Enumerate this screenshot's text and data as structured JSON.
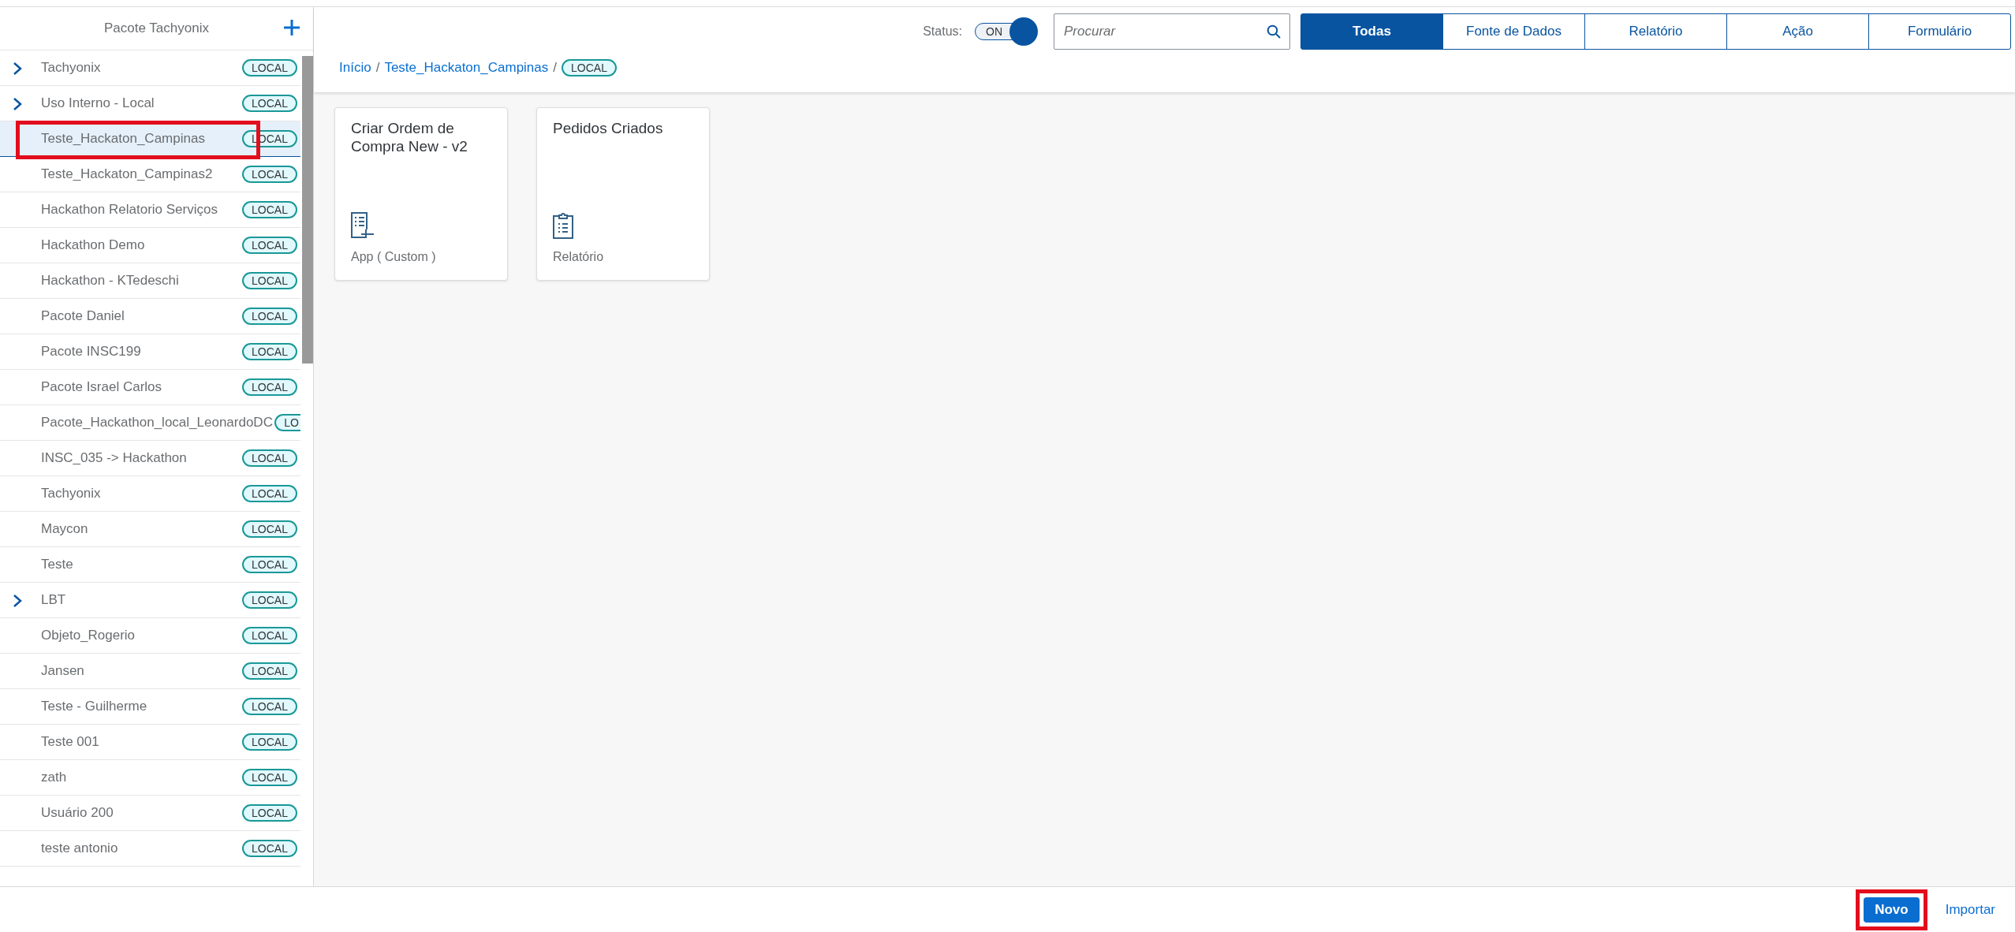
{
  "sidebar": {
    "title": "Pacote Tachyonix",
    "items": [
      {
        "name": "Tachyonix",
        "badge": "LOCAL",
        "expandable": true,
        "selected": false,
        "highlighted": false
      },
      {
        "name": "Uso Interno - Local",
        "badge": "LOCAL",
        "expandable": true,
        "selected": false,
        "highlighted": false
      },
      {
        "name": "Teste_Hackaton_Campinas",
        "badge": "LOCAL",
        "expandable": false,
        "selected": true,
        "highlighted": true
      },
      {
        "name": "Teste_Hackaton_Campinas2",
        "badge": "LOCAL",
        "expandable": false,
        "selected": false,
        "highlighted": false
      },
      {
        "name": "Hackathon Relatorio Serviços",
        "badge": "LOCAL",
        "expandable": false,
        "selected": false,
        "highlighted": false
      },
      {
        "name": "Hackathon Demo",
        "badge": "LOCAL",
        "expandable": false,
        "selected": false,
        "highlighted": false
      },
      {
        "name": "Hackathon - KTedeschi",
        "badge": "LOCAL",
        "expandable": false,
        "selected": false,
        "highlighted": false
      },
      {
        "name": "Pacote Daniel",
        "badge": "LOCAL",
        "expandable": false,
        "selected": false,
        "highlighted": false
      },
      {
        "name": "Pacote INSC199",
        "badge": "LOCAL",
        "expandable": false,
        "selected": false,
        "highlighted": false
      },
      {
        "name": "Pacote Israel Carlos",
        "badge": "LOCAL",
        "expandable": false,
        "selected": false,
        "highlighted": false
      },
      {
        "name": "Pacote_Hackathon_local_LeonardoDC",
        "badge": "LO",
        "expandable": false,
        "selected": false,
        "highlighted": false
      },
      {
        "name": "INSC_035 -> Hackathon",
        "badge": "LOCAL",
        "expandable": false,
        "selected": false,
        "highlighted": false
      },
      {
        "name": "Tachyonix",
        "badge": "LOCAL",
        "expandable": false,
        "selected": false,
        "highlighted": false
      },
      {
        "name": "Maycon",
        "badge": "LOCAL",
        "expandable": false,
        "selected": false,
        "highlighted": false
      },
      {
        "name": "Teste",
        "badge": "LOCAL",
        "expandable": false,
        "selected": false,
        "highlighted": false
      },
      {
        "name": "LBT",
        "badge": "LOCAL",
        "expandable": true,
        "selected": false,
        "highlighted": false
      },
      {
        "name": "Objeto_Rogerio",
        "badge": "LOCAL",
        "expandable": false,
        "selected": false,
        "highlighted": false
      },
      {
        "name": "Jansen",
        "badge": "LOCAL",
        "expandable": false,
        "selected": false,
        "highlighted": false
      },
      {
        "name": "Teste - Guilherme",
        "badge": "LOCAL",
        "expandable": false,
        "selected": false,
        "highlighted": false
      },
      {
        "name": "Teste 001",
        "badge": "LOCAL",
        "expandable": false,
        "selected": false,
        "highlighted": false
      },
      {
        "name": "zath",
        "badge": "LOCAL",
        "expandable": false,
        "selected": false,
        "highlighted": false
      },
      {
        "name": "Usuário 200",
        "badge": "LOCAL",
        "expandable": false,
        "selected": false,
        "highlighted": false
      },
      {
        "name": "teste antonio",
        "badge": "LOCAL",
        "expandable": false,
        "selected": false,
        "highlighted": false
      }
    ]
  },
  "toolbar": {
    "status_label": "Status:",
    "status": {
      "label": "ON",
      "on": true
    },
    "search": {
      "placeholder": "Procurar"
    },
    "filters": [
      {
        "label": "Todas",
        "selected": true
      },
      {
        "label": "Fonte de Dados",
        "selected": false
      },
      {
        "label": "Relatório",
        "selected": false
      },
      {
        "label": "Ação",
        "selected": false
      },
      {
        "label": "Formulário",
        "selected": false
      }
    ]
  },
  "breadcrumb": {
    "links": [
      "Início",
      "Teste_Hackaton_Campinas"
    ],
    "separator": "/",
    "badge": "LOCAL"
  },
  "cards": [
    {
      "title": "Criar Ordem de Compra New - v2",
      "type": "App ( Custom )",
      "kind": "app"
    },
    {
      "title": "Pedidos Criados",
      "type": "Relatório",
      "kind": "report"
    }
  ],
  "footer": {
    "buttons": [
      {
        "label": "Novo",
        "kind": "primary",
        "highlighted": true
      },
      {
        "label": "Importar",
        "kind": "link",
        "highlighted": false
      }
    ]
  }
}
